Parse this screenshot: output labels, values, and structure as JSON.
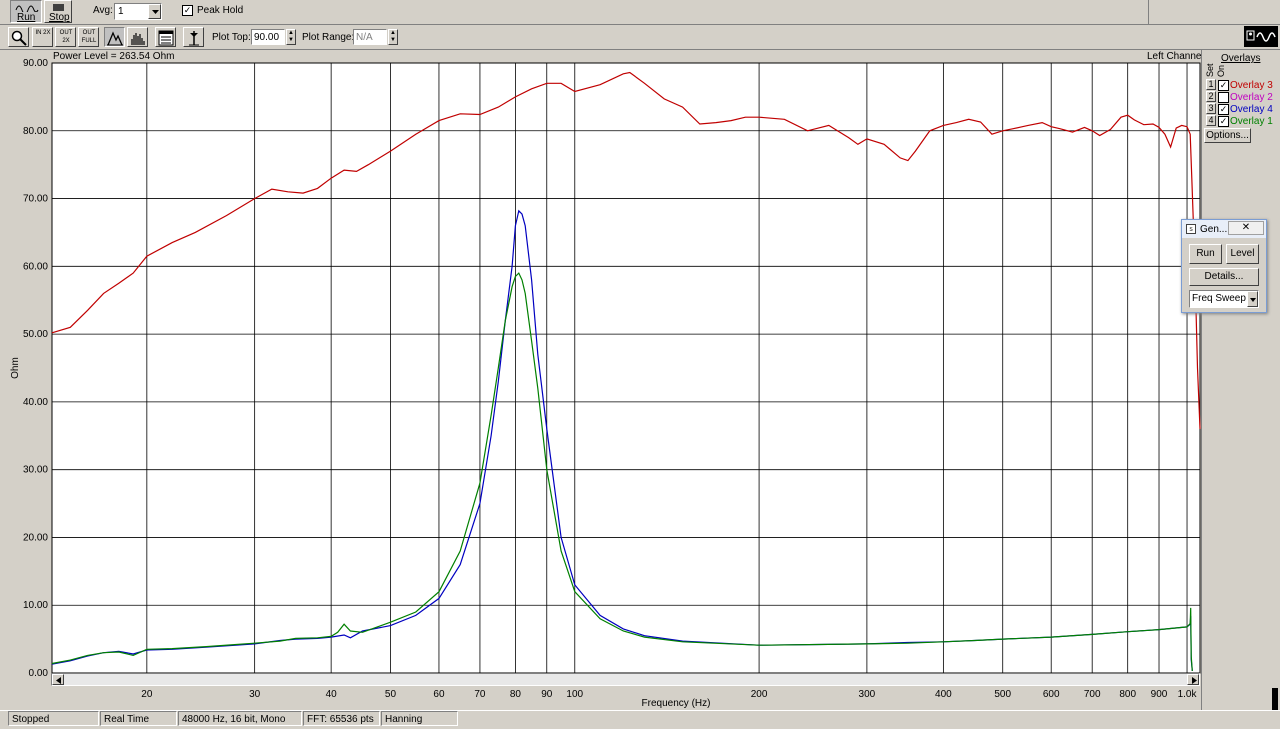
{
  "toolbar": {
    "run_label": "Run",
    "stop_label": "Stop",
    "avg_label": "Avg:",
    "avg_value": "1",
    "peak_hold_label": "Peak Hold",
    "peak_hold_checked": "✓",
    "zoom_in_2x": "IN 2X",
    "zoom_out_2x": "OUT 2X",
    "zoom_out_full": "OUT FULL",
    "plot_top_label": "Plot Top:",
    "plot_top_value": "90.00",
    "plot_range_label": "Plot Range:",
    "plot_range_value": "N/A"
  },
  "plot": {
    "header_left": "Power Level = 263.54 Ohm",
    "header_right": "Left Channel"
  },
  "overlays_panel": {
    "title": "Overlays",
    "set_label": "Set",
    "on_label": "On",
    "items": [
      {
        "num": "1",
        "checked": "✓",
        "name": "Overlay 3",
        "color": "#c00000"
      },
      {
        "num": "2",
        "checked": "",
        "name": "Overlay 2",
        "color": "#c000c0"
      },
      {
        "num": "3",
        "checked": "✓",
        "name": "Overlay 4",
        "color": "#0000c0"
      },
      {
        "num": "4",
        "checked": "✓",
        "name": "Overlay 1",
        "color": "#008000"
      }
    ],
    "options_label": "Options..."
  },
  "generator": {
    "title": "Gen...",
    "close_glyph": "✕",
    "run_label": "Run",
    "level_label": "Level",
    "details_label": "Details...",
    "mode_value": "Freq Sweep"
  },
  "status_bar": {
    "state": "Stopped",
    "mode": "Real Time",
    "format": "48000 Hz, 16 bit, Mono",
    "fft": "FFT: 65536 pts",
    "window": "Hanning"
  },
  "chart_data": {
    "type": "line",
    "title": "",
    "xlabel": "Frequency (Hz)",
    "ylabel": "Ohm",
    "x_scale": "log",
    "xlim": [
      14,
      1050
    ],
    "ylim": [
      0,
      90
    ],
    "grid": true,
    "x_ticks": [
      {
        "value": 20,
        "label": "20"
      },
      {
        "value": 30,
        "label": "30"
      },
      {
        "value": 40,
        "label": "40"
      },
      {
        "value": 50,
        "label": "50"
      },
      {
        "value": 60,
        "label": "60"
      },
      {
        "value": 70,
        "label": "70"
      },
      {
        "value": 80,
        "label": "80"
      },
      {
        "value": 90,
        "label": "90"
      },
      {
        "value": 100,
        "label": "100"
      },
      {
        "value": 200,
        "label": "200"
      },
      {
        "value": 300,
        "label": "300"
      },
      {
        "value": 400,
        "label": "400"
      },
      {
        "value": 500,
        "label": "500"
      },
      {
        "value": 600,
        "label": "600"
      },
      {
        "value": 700,
        "label": "700"
      },
      {
        "value": 800,
        "label": "800"
      },
      {
        "value": 900,
        "label": "900"
      },
      {
        "value": 1000,
        "label": "1.0k"
      }
    ],
    "y_ticks": [
      {
        "value": 0,
        "label": "0.00"
      },
      {
        "value": 10,
        "label": "10.00"
      },
      {
        "value": 20,
        "label": "20.00"
      },
      {
        "value": 30,
        "label": "30.00"
      },
      {
        "value": 40,
        "label": "40.00"
      },
      {
        "value": 50,
        "label": "50.00"
      },
      {
        "value": 60,
        "label": "60.00"
      },
      {
        "value": 70,
        "label": "70.00"
      },
      {
        "value": 80,
        "label": "80.00"
      },
      {
        "value": 90,
        "label": "90.00"
      }
    ],
    "series": [
      {
        "color": "#c00000",
        "points": [
          [
            14,
            50.2
          ],
          [
            15,
            51
          ],
          [
            16,
            53.5
          ],
          [
            17,
            56
          ],
          [
            18,
            57.5
          ],
          [
            19,
            59
          ],
          [
            20,
            61.5
          ],
          [
            22,
            63.5
          ],
          [
            24,
            65
          ],
          [
            27,
            67.5
          ],
          [
            30,
            70
          ],
          [
            32,
            71.4
          ],
          [
            34,
            71
          ],
          [
            36,
            70.8
          ],
          [
            38,
            71.5
          ],
          [
            40,
            73
          ],
          [
            42,
            74.2
          ],
          [
            44,
            74
          ],
          [
            46,
            75
          ],
          [
            50,
            77
          ],
          [
            55,
            79.5
          ],
          [
            60,
            81.5
          ],
          [
            65,
            82.5
          ],
          [
            70,
            82.4
          ],
          [
            75,
            83.5
          ],
          [
            80,
            85
          ],
          [
            85,
            86.2
          ],
          [
            90,
            87
          ],
          [
            95,
            87
          ],
          [
            100,
            85.8
          ],
          [
            110,
            86.8
          ],
          [
            120,
            88.4
          ],
          [
            123,
            88.6
          ],
          [
            130,
            87
          ],
          [
            140,
            84.7
          ],
          [
            150,
            83.5
          ],
          [
            160,
            81
          ],
          [
            170,
            81.2
          ],
          [
            180,
            81.5
          ],
          [
            190,
            82
          ],
          [
            200,
            82
          ],
          [
            220,
            81.7
          ],
          [
            240,
            80
          ],
          [
            260,
            80.8
          ],
          [
            280,
            79
          ],
          [
            290,
            78
          ],
          [
            300,
            78.8
          ],
          [
            320,
            78
          ],
          [
            340,
            76
          ],
          [
            350,
            75.6
          ],
          [
            360,
            77
          ],
          [
            380,
            80
          ],
          [
            400,
            80.8
          ],
          [
            420,
            81.2
          ],
          [
            440,
            81.7
          ],
          [
            460,
            81.3
          ],
          [
            480,
            79.5
          ],
          [
            500,
            80
          ],
          [
            520,
            80.3
          ],
          [
            550,
            80.8
          ],
          [
            580,
            81.2
          ],
          [
            600,
            80.6
          ],
          [
            620,
            80.3
          ],
          [
            650,
            79.8
          ],
          [
            680,
            80.5
          ],
          [
            700,
            80
          ],
          [
            720,
            79.3
          ],
          [
            750,
            80.2
          ],
          [
            780,
            82
          ],
          [
            800,
            82.3
          ],
          [
            820,
            81.6
          ],
          [
            850,
            80.9
          ],
          [
            880,
            81
          ],
          [
            900,
            80.5
          ],
          [
            920,
            79.5
          ],
          [
            940,
            77.6
          ],
          [
            960,
            80.4
          ],
          [
            980,
            80.8
          ],
          [
            1000,
            80.6
          ],
          [
            1012,
            79.5
          ],
          [
            1018,
            73
          ],
          [
            1030,
            60
          ],
          [
            1040,
            45
          ],
          [
            1050,
            36
          ]
        ]
      },
      {
        "color": "#0000c0",
        "points": [
          [
            14,
            1.3
          ],
          [
            15,
            1.8
          ],
          [
            16,
            2.5
          ],
          [
            17,
            3
          ],
          [
            18,
            3.2
          ],
          [
            19,
            2.8
          ],
          [
            20,
            3.4
          ],
          [
            22,
            3.5
          ],
          [
            25,
            3.8
          ],
          [
            28,
            4.1
          ],
          [
            30,
            4.3
          ],
          [
            33,
            4.8
          ],
          [
            35,
            5
          ],
          [
            38,
            5.1
          ],
          [
            40,
            5.3
          ],
          [
            42,
            5.6
          ],
          [
            43,
            5.2
          ],
          [
            45,
            6.2
          ],
          [
            50,
            7
          ],
          [
            55,
            8.5
          ],
          [
            60,
            11
          ],
          [
            65,
            16
          ],
          [
            70,
            25
          ],
          [
            73,
            35
          ],
          [
            75,
            43
          ],
          [
            77,
            52
          ],
          [
            79,
            60
          ],
          [
            80,
            66
          ],
          [
            81,
            68.2
          ],
          [
            82,
            67.7
          ],
          [
            83,
            66
          ],
          [
            85,
            58
          ],
          [
            87,
            47
          ],
          [
            90,
            36
          ],
          [
            95,
            20
          ],
          [
            100,
            13
          ],
          [
            110,
            8.5
          ],
          [
            120,
            6.5
          ],
          [
            130,
            5.5
          ],
          [
            150,
            4.7
          ],
          [
            200,
            4.1
          ],
          [
            250,
            4.2
          ],
          [
            300,
            4.3
          ],
          [
            350,
            4.5
          ],
          [
            400,
            4.6
          ],
          [
            450,
            4.8
          ],
          [
            500,
            5
          ],
          [
            600,
            5.3
          ],
          [
            700,
            5.7
          ],
          [
            800,
            6.1
          ],
          [
            900,
            6.4
          ],
          [
            1000,
            6.8
          ],
          [
            1012,
            7.2
          ],
          [
            1014,
            8.4
          ],
          [
            1016,
            2
          ],
          [
            1020,
            0.3
          ]
        ]
      },
      {
        "color": "#008000",
        "points": [
          [
            14,
            1.4
          ],
          [
            15,
            1.9
          ],
          [
            16,
            2.6
          ],
          [
            17,
            3
          ],
          [
            18,
            3.1
          ],
          [
            19,
            2.6
          ],
          [
            20,
            3.5
          ],
          [
            22,
            3.6
          ],
          [
            25,
            3.9
          ],
          [
            28,
            4.2
          ],
          [
            30,
            4.4
          ],
          [
            33,
            4.7
          ],
          [
            35,
            5.1
          ],
          [
            38,
            5.2
          ],
          [
            40,
            5.4
          ],
          [
            41,
            6
          ],
          [
            42,
            7.2
          ],
          [
            43,
            6.2
          ],
          [
            45,
            6
          ],
          [
            50,
            7.5
          ],
          [
            55,
            9
          ],
          [
            60,
            12
          ],
          [
            65,
            18
          ],
          [
            70,
            28
          ],
          [
            73,
            38
          ],
          [
            75,
            45
          ],
          [
            77,
            52
          ],
          [
            79,
            57
          ],
          [
            80,
            58.5
          ],
          [
            81,
            59
          ],
          [
            82,
            58
          ],
          [
            83,
            56
          ],
          [
            85,
            49
          ],
          [
            87,
            42
          ],
          [
            90,
            30
          ],
          [
            95,
            18
          ],
          [
            100,
            12
          ],
          [
            110,
            8
          ],
          [
            120,
            6.2
          ],
          [
            130,
            5.3
          ],
          [
            150,
            4.6
          ],
          [
            200,
            4.1
          ],
          [
            250,
            4.2
          ],
          [
            300,
            4.3
          ],
          [
            350,
            4.4
          ],
          [
            400,
            4.6
          ],
          [
            450,
            4.8
          ],
          [
            500,
            5
          ],
          [
            600,
            5.3
          ],
          [
            700,
            5.7
          ],
          [
            800,
            6.1
          ],
          [
            900,
            6.4
          ],
          [
            1000,
            6.8
          ],
          [
            1012,
            7.3
          ],
          [
            1014,
            9.6
          ],
          [
            1016,
            2.5
          ],
          [
            1020,
            0.3
          ]
        ]
      }
    ]
  }
}
